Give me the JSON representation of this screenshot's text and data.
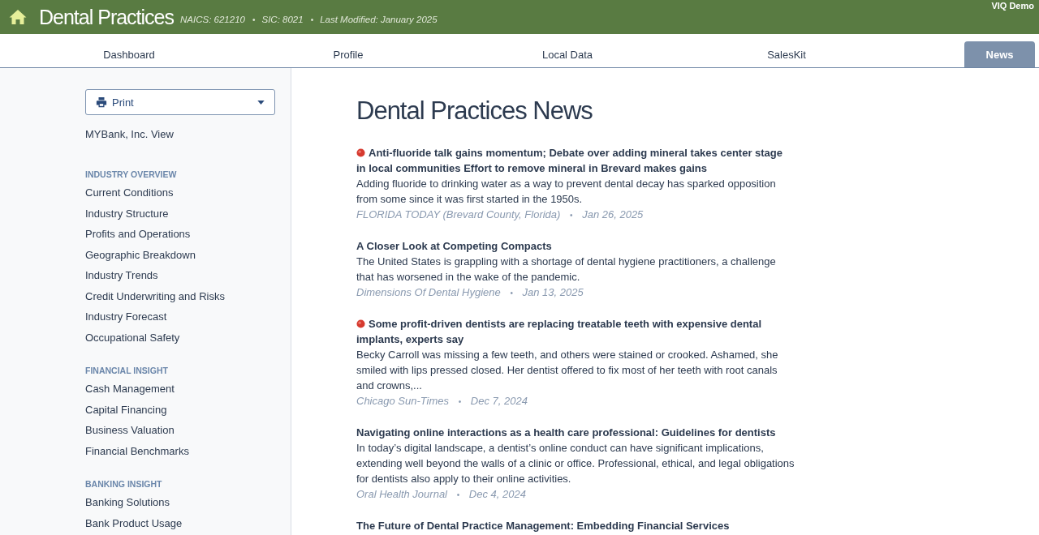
{
  "header": {
    "title": "Dental Practices",
    "meta": [
      {
        "text": "NAICS: 621210"
      },
      {
        "separator": "•",
        "text": "SIC: 8021"
      },
      {
        "separator": "•",
        "text": "Last Modified: January 2025"
      }
    ],
    "user": "VIQ Demo"
  },
  "tabs": [
    {
      "label": "Dashboard",
      "selected": false
    },
    {
      "label": "Profile",
      "selected": false
    },
    {
      "label": "Local Data",
      "selected": false
    },
    {
      "label": "SalesKit",
      "selected": false
    },
    {
      "label": "News",
      "selected": true
    }
  ],
  "sidebar": {
    "print_button": "Print",
    "view_link": "MYBank, Inc. View",
    "sections": [
      {
        "heading": "INDUSTRY OVERVIEW",
        "items": [
          "Current Conditions",
          "Industry Structure",
          "Profits and Operations",
          "Geographic Breakdown",
          "Industry Trends",
          "Credit Underwriting and Risks",
          "Industry Forecast",
          "Occupational Safety"
        ]
      },
      {
        "heading": "FINANCIAL INSIGHT",
        "items": [
          "Cash Management",
          "Capital Financing",
          "Business Valuation",
          "Financial Benchmarks"
        ]
      },
      {
        "heading": "BANKING INSIGHT",
        "items": [
          "Banking Solutions",
          "Bank Product Usage"
        ]
      }
    ]
  },
  "main": {
    "title": "Dental Practices News",
    "articles": [
      {
        "flagged": true,
        "headline": "Anti-fluoride talk gains momentum; Debate over adding mineral takes center stage in local communities Effort to remove mineral in Brevard makes gains",
        "summary": "Adding fluoride to drinking water as a way to prevent dental decay has sparked opposition from some since it was first started in the 1950s.",
        "source": "FLORIDA TODAY (Brevard County, Florida)",
        "separator": "•",
        "date": "Jan 26, 2025"
      },
      {
        "flagged": false,
        "headline": "A Closer Look at Competing Compacts",
        "summary": "The United States is grappling with a shortage of dental hygiene practitioners, a challenge that has worsened in the wake of the pandemic.",
        "source": "Dimensions Of Dental Hygiene",
        "separator": "•",
        "date": "Jan 13, 2025"
      },
      {
        "flagged": true,
        "headline": "Some profit-driven dentists are replacing treatable teeth with expensive dental implants, experts say",
        "summary": "Becky Carroll was missing a few teeth, and others were stained or crooked. Ashamed, she smiled with lips pressed closed. Her dentist offered to fix most of her teeth with root canals and crowns,...",
        "source": "Chicago Sun-Times",
        "separator": "•",
        "date": "Dec 7, 2024"
      },
      {
        "flagged": false,
        "headline": "Navigating online interactions as a health care professional: Guidelines for dentists",
        "summary": "In today’s digital landscape, a dentist’s online conduct can have significant implications, extending well beyond the walls of a clinic or office. Professional, ethical, and legal obligations for dentists also apply to their online activities.",
        "source": "Oral Health Journal",
        "separator": "•",
        "date": "Dec 4, 2024"
      },
      {
        "flagged": false,
        "headline": "The Future of Dental Practice Management: Embedding Financial Services"
      }
    ]
  }
}
